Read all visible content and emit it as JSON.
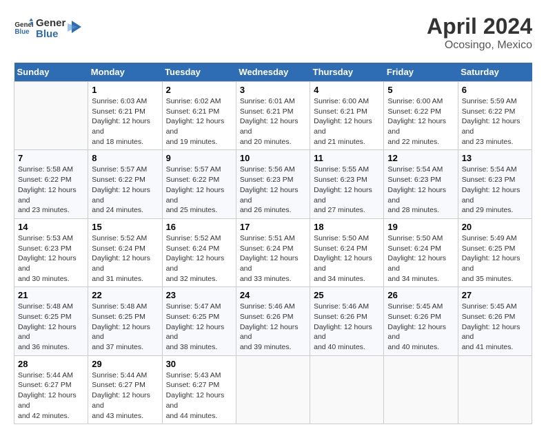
{
  "header": {
    "logo_general": "General",
    "logo_blue": "Blue",
    "month_title": "April 2024",
    "location": "Ocosingo, Mexico"
  },
  "days_of_week": [
    "Sunday",
    "Monday",
    "Tuesday",
    "Wednesday",
    "Thursday",
    "Friday",
    "Saturday"
  ],
  "weeks": [
    [
      {
        "day": "",
        "sunrise": "",
        "sunset": "",
        "daylight": ""
      },
      {
        "day": "1",
        "sunrise": "Sunrise: 6:03 AM",
        "sunset": "Sunset: 6:21 PM",
        "daylight": "Daylight: 12 hours and 18 minutes."
      },
      {
        "day": "2",
        "sunrise": "Sunrise: 6:02 AM",
        "sunset": "Sunset: 6:21 PM",
        "daylight": "Daylight: 12 hours and 19 minutes."
      },
      {
        "day": "3",
        "sunrise": "Sunrise: 6:01 AM",
        "sunset": "Sunset: 6:21 PM",
        "daylight": "Daylight: 12 hours and 20 minutes."
      },
      {
        "day": "4",
        "sunrise": "Sunrise: 6:00 AM",
        "sunset": "Sunset: 6:21 PM",
        "daylight": "Daylight: 12 hours and 21 minutes."
      },
      {
        "day": "5",
        "sunrise": "Sunrise: 6:00 AM",
        "sunset": "Sunset: 6:22 PM",
        "daylight": "Daylight: 12 hours and 22 minutes."
      },
      {
        "day": "6",
        "sunrise": "Sunrise: 5:59 AM",
        "sunset": "Sunset: 6:22 PM",
        "daylight": "Daylight: 12 hours and 23 minutes."
      }
    ],
    [
      {
        "day": "7",
        "sunrise": "Sunrise: 5:58 AM",
        "sunset": "Sunset: 6:22 PM",
        "daylight": "Daylight: 12 hours and 23 minutes."
      },
      {
        "day": "8",
        "sunrise": "Sunrise: 5:57 AM",
        "sunset": "Sunset: 6:22 PM",
        "daylight": "Daylight: 12 hours and 24 minutes."
      },
      {
        "day": "9",
        "sunrise": "Sunrise: 5:57 AM",
        "sunset": "Sunset: 6:22 PM",
        "daylight": "Daylight: 12 hours and 25 minutes."
      },
      {
        "day": "10",
        "sunrise": "Sunrise: 5:56 AM",
        "sunset": "Sunset: 6:23 PM",
        "daylight": "Daylight: 12 hours and 26 minutes."
      },
      {
        "day": "11",
        "sunrise": "Sunrise: 5:55 AM",
        "sunset": "Sunset: 6:23 PM",
        "daylight": "Daylight: 12 hours and 27 minutes."
      },
      {
        "day": "12",
        "sunrise": "Sunrise: 5:54 AM",
        "sunset": "Sunset: 6:23 PM",
        "daylight": "Daylight: 12 hours and 28 minutes."
      },
      {
        "day": "13",
        "sunrise": "Sunrise: 5:54 AM",
        "sunset": "Sunset: 6:23 PM",
        "daylight": "Daylight: 12 hours and 29 minutes."
      }
    ],
    [
      {
        "day": "14",
        "sunrise": "Sunrise: 5:53 AM",
        "sunset": "Sunset: 6:23 PM",
        "daylight": "Daylight: 12 hours and 30 minutes."
      },
      {
        "day": "15",
        "sunrise": "Sunrise: 5:52 AM",
        "sunset": "Sunset: 6:24 PM",
        "daylight": "Daylight: 12 hours and 31 minutes."
      },
      {
        "day": "16",
        "sunrise": "Sunrise: 5:52 AM",
        "sunset": "Sunset: 6:24 PM",
        "daylight": "Daylight: 12 hours and 32 minutes."
      },
      {
        "day": "17",
        "sunrise": "Sunrise: 5:51 AM",
        "sunset": "Sunset: 6:24 PM",
        "daylight": "Daylight: 12 hours and 33 minutes."
      },
      {
        "day": "18",
        "sunrise": "Sunrise: 5:50 AM",
        "sunset": "Sunset: 6:24 PM",
        "daylight": "Daylight: 12 hours and 34 minutes."
      },
      {
        "day": "19",
        "sunrise": "Sunrise: 5:50 AM",
        "sunset": "Sunset: 6:24 PM",
        "daylight": "Daylight: 12 hours and 34 minutes."
      },
      {
        "day": "20",
        "sunrise": "Sunrise: 5:49 AM",
        "sunset": "Sunset: 6:25 PM",
        "daylight": "Daylight: 12 hours and 35 minutes."
      }
    ],
    [
      {
        "day": "21",
        "sunrise": "Sunrise: 5:48 AM",
        "sunset": "Sunset: 6:25 PM",
        "daylight": "Daylight: 12 hours and 36 minutes."
      },
      {
        "day": "22",
        "sunrise": "Sunrise: 5:48 AM",
        "sunset": "Sunset: 6:25 PM",
        "daylight": "Daylight: 12 hours and 37 minutes."
      },
      {
        "day": "23",
        "sunrise": "Sunrise: 5:47 AM",
        "sunset": "Sunset: 6:25 PM",
        "daylight": "Daylight: 12 hours and 38 minutes."
      },
      {
        "day": "24",
        "sunrise": "Sunrise: 5:46 AM",
        "sunset": "Sunset: 6:26 PM",
        "daylight": "Daylight: 12 hours and 39 minutes."
      },
      {
        "day": "25",
        "sunrise": "Sunrise: 5:46 AM",
        "sunset": "Sunset: 6:26 PM",
        "daylight": "Daylight: 12 hours and 40 minutes."
      },
      {
        "day": "26",
        "sunrise": "Sunrise: 5:45 AM",
        "sunset": "Sunset: 6:26 PM",
        "daylight": "Daylight: 12 hours and 40 minutes."
      },
      {
        "day": "27",
        "sunrise": "Sunrise: 5:45 AM",
        "sunset": "Sunset: 6:26 PM",
        "daylight": "Daylight: 12 hours and 41 minutes."
      }
    ],
    [
      {
        "day": "28",
        "sunrise": "Sunrise: 5:44 AM",
        "sunset": "Sunset: 6:27 PM",
        "daylight": "Daylight: 12 hours and 42 minutes."
      },
      {
        "day": "29",
        "sunrise": "Sunrise: 5:44 AM",
        "sunset": "Sunset: 6:27 PM",
        "daylight": "Daylight: 12 hours and 43 minutes."
      },
      {
        "day": "30",
        "sunrise": "Sunrise: 5:43 AM",
        "sunset": "Sunset: 6:27 PM",
        "daylight": "Daylight: 12 hours and 44 minutes."
      },
      {
        "day": "",
        "sunrise": "",
        "sunset": "",
        "daylight": ""
      },
      {
        "day": "",
        "sunrise": "",
        "sunset": "",
        "daylight": ""
      },
      {
        "day": "",
        "sunrise": "",
        "sunset": "",
        "daylight": ""
      },
      {
        "day": "",
        "sunrise": "",
        "sunset": "",
        "daylight": ""
      }
    ]
  ]
}
